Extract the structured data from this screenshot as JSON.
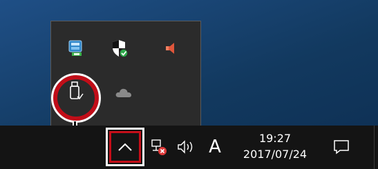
{
  "tray_flyout": {
    "icons": [
      {
        "name": "network-drive-icon"
      },
      {
        "name": "windows-defender-icon"
      },
      {
        "name": "speaker-alert-icon"
      },
      {
        "name": "usb-safely-remove-icon"
      },
      {
        "name": "onedrive-icon"
      }
    ]
  },
  "taskbar": {
    "ime_mode": "A",
    "clock": {
      "time": "19:27",
      "date": "2017/07/24"
    }
  },
  "colors": {
    "highlight": "#c40d18",
    "taskbar": "#141414",
    "flyout": "#2b2b2b"
  }
}
